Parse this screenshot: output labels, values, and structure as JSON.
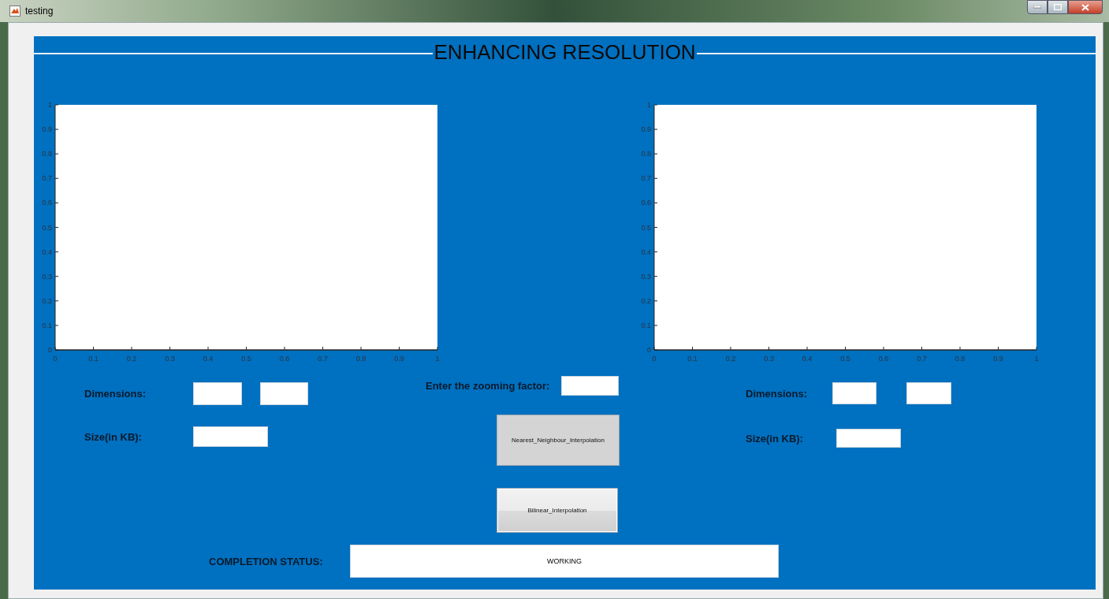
{
  "window": {
    "title": "testing"
  },
  "panel": {
    "title": "ENHANCING RESOLUTION"
  },
  "axes": [
    {
      "chart_data": {
        "type": "line",
        "xlim": [
          0,
          1
        ],
        "ylim": [
          0,
          1
        ],
        "xticks": [
          0,
          0.1,
          0.2,
          0.3,
          0.4,
          0.5,
          0.6,
          0.7,
          0.8,
          0.9,
          1
        ],
        "yticks": [
          0,
          0.1,
          0.2,
          0.3,
          0.4,
          0.5,
          0.6,
          0.7,
          0.8,
          0.9,
          1
        ]
      }
    },
    {
      "chart_data": {
        "type": "line",
        "xlim": [
          0,
          1
        ],
        "ylim": [
          0,
          1
        ],
        "xticks": [
          0,
          0.1,
          0.2,
          0.3,
          0.4,
          0.5,
          0.6,
          0.7,
          0.8,
          0.9,
          1
        ],
        "yticks": [
          0,
          0.1,
          0.2,
          0.3,
          0.4,
          0.5,
          0.6,
          0.7,
          0.8,
          0.9,
          1
        ]
      }
    }
  ],
  "input_image": {
    "dimensions_label": "Dimensions:",
    "size_label": "Size(in KB):"
  },
  "zoom": {
    "label": "Enter the zooming factor:"
  },
  "buttons": [
    {
      "label": "Nearest_Neighbour_Interpolation",
      "focused": false
    },
    {
      "label": "Bilinear_Interpolation",
      "focused": true
    }
  ],
  "output_image": {
    "dimensions_label": "Dimensions:",
    "size_label": "Size(in KB):"
  },
  "status": {
    "label": "COMPLETION STATUS:",
    "value": "WORKING"
  }
}
